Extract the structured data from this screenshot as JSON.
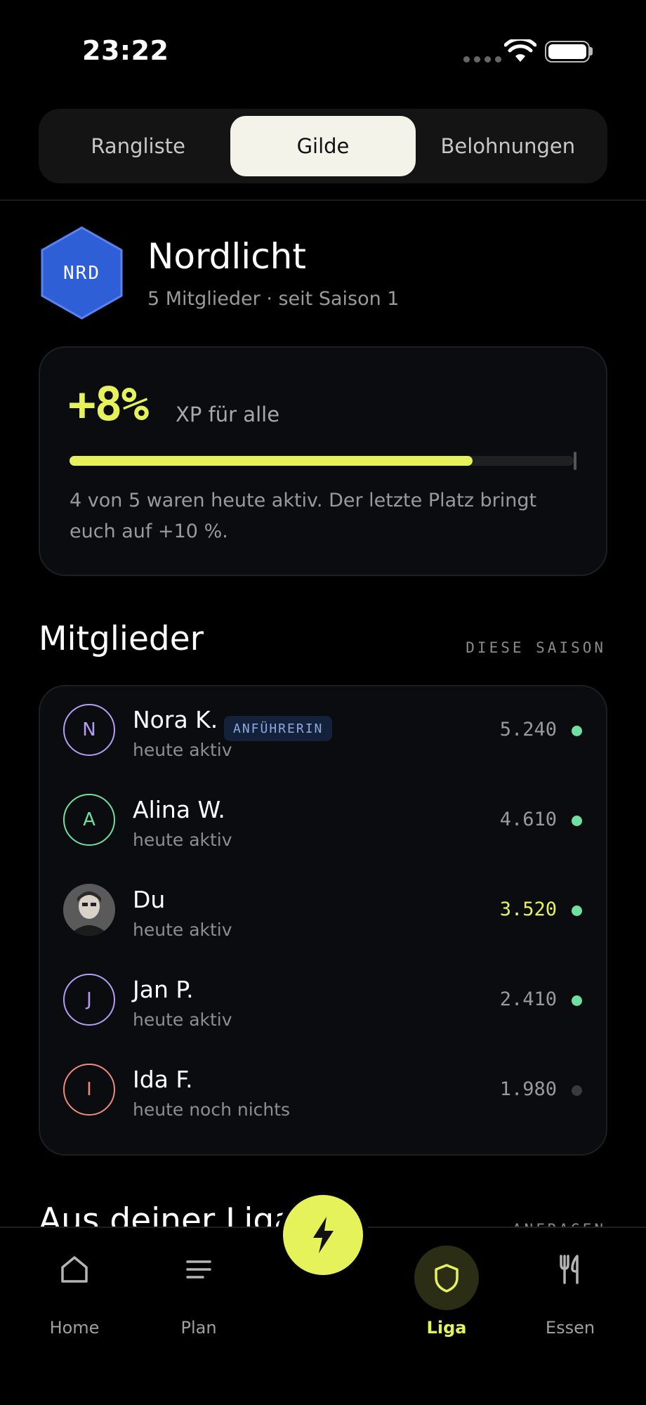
{
  "status_bar": {
    "time": "23:22"
  },
  "tabs": [
    {
      "label": "Rangliste",
      "active": false
    },
    {
      "label": "Gilde",
      "active": true
    },
    {
      "label": "Belohnungen",
      "active": false
    }
  ],
  "guild": {
    "badge_code": "NRD",
    "name": "Nordlicht",
    "subtitle": "5 Mitglieder · seit Saison 1"
  },
  "xp_card": {
    "bonus": "+8%",
    "label": "XP für alle",
    "progress": 0.8,
    "description": "4 von 5 waren heute aktiv. Der letzte Platz bringt euch auf +10 %."
  },
  "members_section": {
    "title": "Mitglieder",
    "tag": "DIESE SAISON",
    "members": [
      {
        "initial": "N",
        "name": "Nora K.",
        "badge": "ANFÜHRERIN",
        "status": "heute aktiv",
        "xp": "5.240",
        "active": true,
        "color": "#b79cf5"
      },
      {
        "initial": "A",
        "name": "Alina W.",
        "badge": "",
        "status": "heute aktiv",
        "xp": "4.610",
        "active": true,
        "color": "#6ee0a2"
      },
      {
        "initial": "",
        "name": "Du",
        "badge": "",
        "status": "heute aktiv",
        "xp": "3.520",
        "active": true,
        "color": "#e6f25a",
        "self": true
      },
      {
        "initial": "J",
        "name": "Jan P.",
        "badge": "",
        "status": "heute aktiv",
        "xp": "2.410",
        "active": true,
        "color": "#b79cf5"
      },
      {
        "initial": "I",
        "name": "Ida F.",
        "badge": "",
        "status": "heute noch nichts",
        "xp": "1.980",
        "active": false,
        "color": "#f08a7a"
      }
    ]
  },
  "league_section": {
    "title": "Aus deiner Liga",
    "tag": "ANFRAGEN"
  },
  "bottom_nav": [
    {
      "label": "Home",
      "icon": "home-icon",
      "active": false
    },
    {
      "label": "Plan",
      "icon": "list-icon",
      "active": false
    },
    {
      "label": "Liga",
      "icon": "shield-icon",
      "active": true
    },
    {
      "label": "Essen",
      "icon": "fork-knife-icon",
      "active": false
    }
  ],
  "fab": {
    "icon": "lightning-icon"
  },
  "colors": {
    "accent": "#e6f25a",
    "active_dot": "#6ee0a2",
    "inactive_dot": "#3a3a3a",
    "badge_blue": "#2f5fd6"
  }
}
